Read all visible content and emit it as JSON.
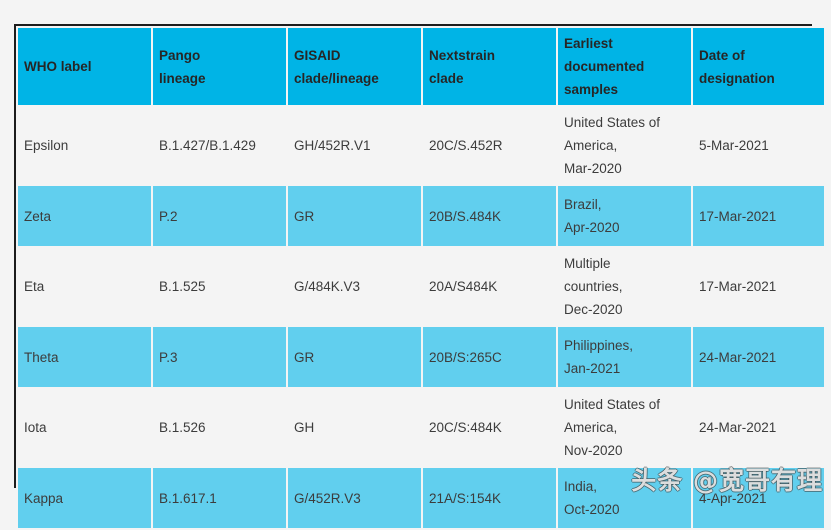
{
  "table": {
    "columns": [
      {
        "key": "who",
        "label": "WHO label"
      },
      {
        "key": "pango",
        "label": "Pango lineage"
      },
      {
        "key": "gisaid",
        "label": "GISAID clade/lineage"
      },
      {
        "key": "nextstr",
        "label": "Nextstrain clade"
      },
      {
        "key": "earliest",
        "label": "Earliest documented samples"
      },
      {
        "key": "date",
        "label": "Date of designation"
      }
    ],
    "header": {
      "who": "WHO label",
      "pango_line1": "Pango",
      "pango_line2": "lineage",
      "gisaid_line1": "GISAID",
      "gisaid_line2": "clade/lineage",
      "nextstr_line1": "Nextstrain",
      "nextstr_line2": "clade",
      "earliest_line1": "Earliest",
      "earliest_line2": "documented",
      "earliest_line3": "samples",
      "date_line1": "Date of",
      "date_line2": "designation"
    },
    "rows": [
      {
        "style": "plain",
        "who": "Epsilon",
        "pango": "B.1.427/B.1.429",
        "gisaid": "GH/452R.V1",
        "nextstr": "20C/S.452R",
        "earliest_line1": "United States of",
        "earliest_line2": "America,",
        "earliest_line3": "Mar-2020",
        "date": "5-Mar-2021"
      },
      {
        "style": "alt",
        "who": "Zeta",
        "pango": "P.2",
        "gisaid": "GR",
        "nextstr": "20B/S.484K",
        "earliest_line1": "Brazil,",
        "earliest_line2": "Apr-2020",
        "earliest_line3": "",
        "date": "17-Mar-2021"
      },
      {
        "style": "plain",
        "who": "Eta",
        "pango": "B.1.525",
        "gisaid": "G/484K.V3",
        "nextstr": "20A/S484K",
        "earliest_line1": "Multiple",
        "earliest_line2": "countries,",
        "earliest_line3": "Dec-2020",
        "date": "17-Mar-2021"
      },
      {
        "style": "alt",
        "who": "Theta",
        "pango": "P.3",
        "gisaid": "GR",
        "nextstr": "20B/S:265C",
        "earliest_line1": "Philippines,",
        "earliest_line2": "Jan-2021",
        "earliest_line3": "",
        "date": "24-Mar-2021"
      },
      {
        "style": "plain",
        "who": "Iota",
        "pango": "B.1.526",
        "gisaid": "GH",
        "nextstr": "20C/S:484K",
        "earliest_line1": "United States of",
        "earliest_line2": "America,",
        "earliest_line3": "Nov-2020",
        "date": "24-Mar-2021"
      },
      {
        "style": "alt",
        "who": "Kappa",
        "pango": "B.1.617.1",
        "gisaid": "G/452R.V3",
        "nextstr": "21A/S:154K",
        "earliest_line1": "India,",
        "earliest_line2": "Oct-2020",
        "earliest_line3": "",
        "date": "4-Apr-2021"
      }
    ]
  },
  "watermark": {
    "text": "头条 @宽哥有理"
  },
  "colors": {
    "header_cyan": "#00b4e6",
    "row_alt_cyan": "#61cfee",
    "row_plain_bg": "#f4f4f4",
    "page_bg": "#f4f4f4",
    "text": "#3c3c3c",
    "border": "#1c1c1c"
  }
}
